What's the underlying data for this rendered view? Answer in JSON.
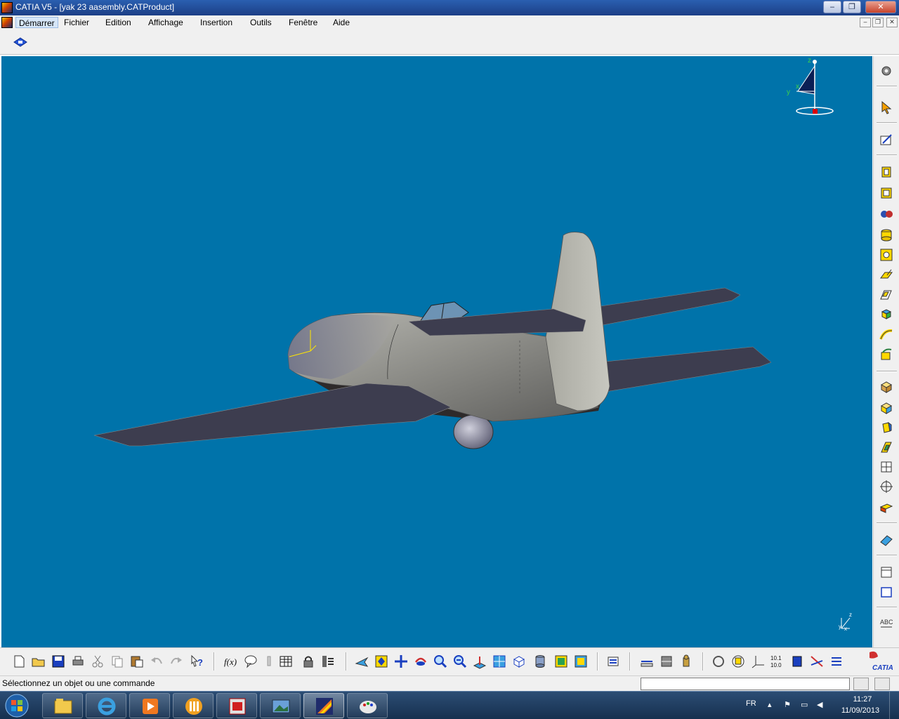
{
  "window": {
    "title": "CATIA V5 - [yak 23 aasembly.CATProduct]",
    "minimize": "‒",
    "maximize": "❐",
    "close": "✕"
  },
  "menu": {
    "items": [
      {
        "label": "Démarrer",
        "active": true
      },
      {
        "label": "Fichier"
      },
      {
        "label": "Edition"
      },
      {
        "label": "Affichage"
      },
      {
        "label": "Insertion"
      },
      {
        "label": "Outils"
      },
      {
        "label": "Fenêtre"
      },
      {
        "label": "Aide"
      }
    ]
  },
  "compass": {
    "z": "z",
    "y": "y",
    "x": "x"
  },
  "axis_indicator": {
    "z": "z",
    "y": "y",
    "x": "x"
  },
  "right_toolbar": {
    "icons": [
      "gear-icon",
      "select-arrow-icon",
      "sketch-icon",
      "view-front-icon",
      "view-top-icon",
      "gears-icon",
      "cylinder-icon",
      "hole-icon",
      "pad-icon",
      "pocket-icon",
      "cube-icon",
      "sweep-icon",
      "rib-icon",
      "box-icon",
      "loft-icon",
      "solid-icon",
      "shell-icon",
      "grid-icon",
      "target-icon",
      "block-icon",
      "eraser-icon",
      "measure-icon",
      "frame-icon",
      "text-icon"
    ]
  },
  "bottom_toolbar": {
    "icons": [
      "new-icon",
      "open-icon",
      "save-icon",
      "print-icon",
      "cut-icon",
      "copy-icon",
      "paste-icon",
      "undo-icon",
      "redo-icon",
      "whats-this-icon",
      "formula-icon",
      "comment-icon",
      "pin-icon",
      "table-icon",
      "lock-icon",
      "catalog-icon",
      "fly-icon",
      "fit-all-icon",
      "pan-icon",
      "rotate-icon",
      "zoom-in-icon",
      "zoom-out-icon",
      "normal-view-icon",
      "multi-view-icon",
      "iso-view-icon",
      "shading-icon",
      "hide-show-icon",
      "swap-icon",
      "update-icon",
      "measure-between-icon",
      "measure-item-icon",
      "inertia-icon",
      "reframe-icon",
      "hand-icon",
      "axis-icon",
      "scale-icon",
      "product-icon",
      "constraint-icon",
      "list-icon"
    ],
    "catia_logo": "CATIA"
  },
  "status": {
    "message": "Sélectionnez un objet ou une commande",
    "command_input": ""
  },
  "taskbar": {
    "apps": [
      "explorer-icon",
      "internet-explorer-icon",
      "media-player-icon",
      "app-icon",
      "acrobat-icon",
      "image-viewer-icon",
      "catia-icon",
      "paint-icon"
    ],
    "language": "FR",
    "time": "11:27",
    "date": "11/09/2013"
  },
  "colors": {
    "viewport_background": "#0073aa",
    "fuselage": "#8f8f8a",
    "wings": "#3d3d4f"
  }
}
